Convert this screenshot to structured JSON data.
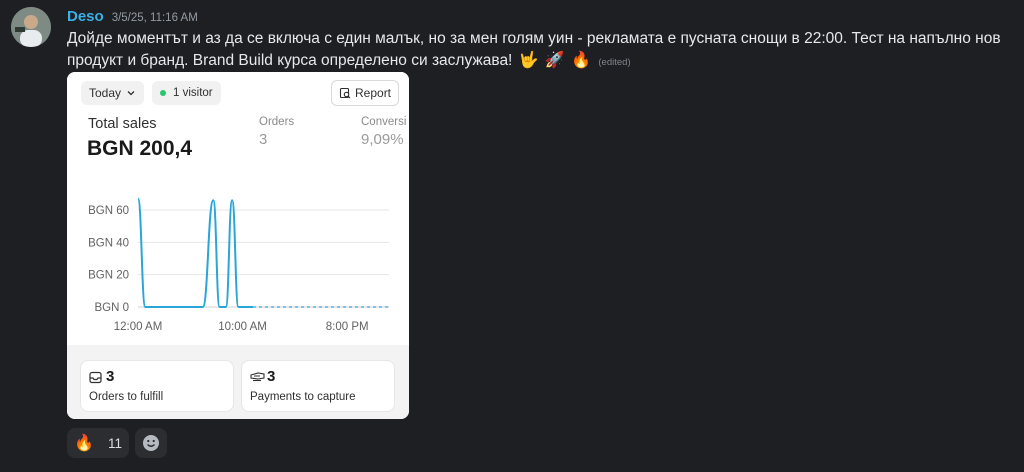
{
  "message": {
    "username": "Deso",
    "timestamp": "3/5/25, 11:16 AM",
    "text": "Дойде моментът и аз да се включа с един малък, но за мен голям уин - рекламата е пусната снощи в 22:00. Тест на напълно нов продукт и бранд. Brand Build курса определено си заслужава!",
    "emojis": [
      "🤟",
      "🚀",
      "🔥"
    ],
    "edited_label": "(edited)"
  },
  "embed": {
    "period_label": "Today",
    "visitors_label": "1 visitor",
    "report_label": "Report",
    "total_sales_label": "Total sales",
    "total_sales_value": "BGN 200,4",
    "orders_label": "Orders",
    "orders_value": "3",
    "conversion_label": "Conversi",
    "conversion_value": "9,09%",
    "cards": [
      {
        "count": "3",
        "label": "Orders to fulfill",
        "icon": "inbox-icon"
      },
      {
        "count": "3",
        "label": "Payments to capture",
        "icon": "payment-icon"
      }
    ]
  },
  "chart_data": {
    "type": "line",
    "y_ticks": [
      "BGN 60",
      "BGN 40",
      "BGN 20",
      "BGN 0"
    ],
    "x_ticks": [
      "12:00 AM",
      "10:00 AM",
      "8:00 PM"
    ],
    "ylim": [
      0,
      60
    ],
    "x_hours_range": [
      0,
      24
    ],
    "series": [
      {
        "x": [
          0,
          0.7,
          5.5,
          6.2,
          7.2,
          7.8,
          8.4,
          9.0,
          9.6,
          10.2,
          11.0
        ],
        "y": [
          67,
          0,
          0,
          0,
          66,
          0,
          0,
          66,
          0,
          0,
          0
        ],
        "color": "#29a5d6"
      }
    ],
    "dashed_zero_from_hour": 11.0,
    "grid": true
  },
  "reactions": [
    {
      "emoji": "🔥",
      "count": "11"
    }
  ],
  "add_reaction_icon": "smiley-add-icon"
}
